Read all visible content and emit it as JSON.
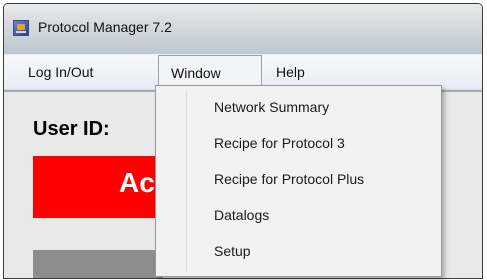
{
  "window": {
    "title": "Protocol Manager 7.2",
    "icon": "protocol-manager-app-icon"
  },
  "menubar": {
    "items": [
      {
        "label": "Log In/Out"
      },
      {
        "label": "Window",
        "state": "open"
      },
      {
        "label": "Help"
      }
    ]
  },
  "dropdown": {
    "items": [
      {
        "label": "Network Summary"
      },
      {
        "label": "Recipe for Protocol 3"
      },
      {
        "label": "Recipe for Protocol Plus"
      },
      {
        "label": "Datalogs"
      },
      {
        "label": "Setup"
      }
    ]
  },
  "content": {
    "user_id_label": "User ID:",
    "status_text": "Ac",
    "status_color": "#ff0000"
  }
}
